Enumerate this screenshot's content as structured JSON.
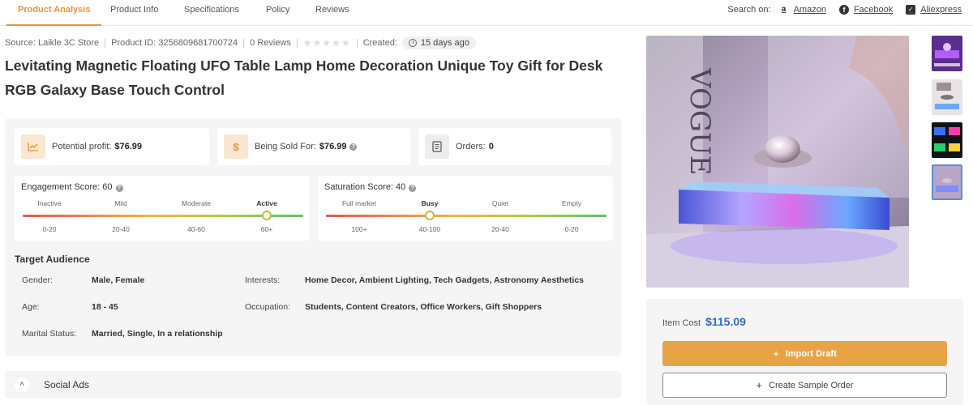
{
  "nav": {
    "tabs": [
      {
        "label": "Product Analysis",
        "active": true
      },
      {
        "label": "Product Info"
      },
      {
        "label": "Specifications"
      },
      {
        "label": "Policy"
      },
      {
        "label": "Reviews"
      }
    ],
    "search_on_label": "Search on:",
    "sites": [
      {
        "label": "Amazon",
        "icon": "amazon-icon"
      },
      {
        "label": "Facebook",
        "icon": "facebook-icon"
      },
      {
        "label": "Aliexpress",
        "icon": "mail-icon"
      }
    ]
  },
  "meta": {
    "source": "Source: Laikle 3C Store",
    "product_id": "Product ID: 3256809681700724",
    "reviews": "0 Reviews",
    "rating": 0,
    "created_label": "Created:",
    "created_value": "15 days ago"
  },
  "product": {
    "title": "Levitating Magnetic Floating UFO Table Lamp Home Decoration Unique Toy Gift for Desk RGB Galaxy Base Touch Control"
  },
  "stats": {
    "profit_label": "Potential profit:",
    "profit_value": "$76.99",
    "sold_label": "Being Sold For:",
    "sold_value": "$76.99",
    "orders_label": "Orders:",
    "orders_value": "0"
  },
  "engagement": {
    "title": "Engagement Score: 60",
    "score": 60,
    "levels": [
      "Inactive",
      "Mild",
      "Moderate",
      "Active"
    ],
    "ranges": [
      "0-20",
      "20-40",
      "40-60",
      "60+"
    ],
    "active_index": 3
  },
  "saturation": {
    "title": "Saturation Score: 40",
    "score": 40,
    "levels": [
      "Full market",
      "Busy",
      "Quiet",
      "Empty"
    ],
    "ranges": [
      "100+",
      "40-100",
      "20-40",
      "0-20"
    ],
    "active_index": 1
  },
  "audience": {
    "title": "Target Audience",
    "gender_label": "Gender:",
    "gender": "Male, Female",
    "age_label": "Age:",
    "age": "18 - 45",
    "marital_label": "Marital Status:",
    "marital": "Married, Single, In a relationship",
    "interests_label": "Interests:",
    "interests": "Home Decor, Ambient Lighting, Tech Gadgets, Astronomy Aesthetics",
    "occupation_label": "Occupation:",
    "occupation": "Students, Content Creators, Office Workers, Gift Shoppers"
  },
  "social": {
    "label": "Social Ads"
  },
  "buy": {
    "cost_label": "Item Cost",
    "cost_value": "$115.09",
    "import_label": "Import Draft",
    "sample_label": "Create Sample Order"
  },
  "colors": {
    "accent": "#e8923b",
    "price": "#2a6cc4",
    "import_button": "#e8a347"
  }
}
